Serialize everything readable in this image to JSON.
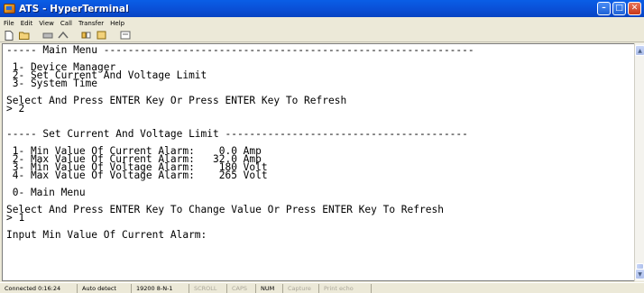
{
  "window": {
    "title": "ATS - HyperTerminal"
  },
  "menu": [
    "File",
    "Edit",
    "View",
    "Call",
    "Transfer",
    "Help"
  ],
  "toolbar": {
    "icons": [
      "new-icon",
      "open-icon",
      "connect-icon",
      "disconnect-icon",
      "send-icon",
      "receive-icon",
      "properties-icon"
    ]
  },
  "terminal": {
    "lines": [
      "----- Main Menu -------------------------------------------------------------",
      "",
      " 1- Device Manager",
      " 2- Set Current And Voltage Limit",
      " 3- System Time",
      "",
      "Select And Press ENTER Key Or Press ENTER Key To Refresh",
      "> 2",
      "",
      "",
      "----- Set Current And Voltage Limit ----------------------------------------",
      "",
      " 1- Min Value Of Current Alarm:    0.0 Amp",
      " 2- Max Value Of Current Alarm:   32.0 Amp",
      " 3- Min Value Of Voltage Alarm:    180 Volt",
      " 4- Max Value Of Voltage Alarm:    265 Volt",
      "",
      " 0- Main Menu",
      "",
      "Select And Press ENTER Key To Change Value Or Press ENTER Key To Refresh",
      "> 1",
      "",
      "Input Min Value Of Current Alarm:"
    ]
  },
  "status": {
    "connected": "Connected 0:16:24",
    "detect": "Auto detect",
    "settings": "19200 8-N-1",
    "scroll": "SCROLL",
    "caps": "CAPS",
    "num": "NUM",
    "capture": "Capture",
    "print_echo": "Print echo"
  }
}
